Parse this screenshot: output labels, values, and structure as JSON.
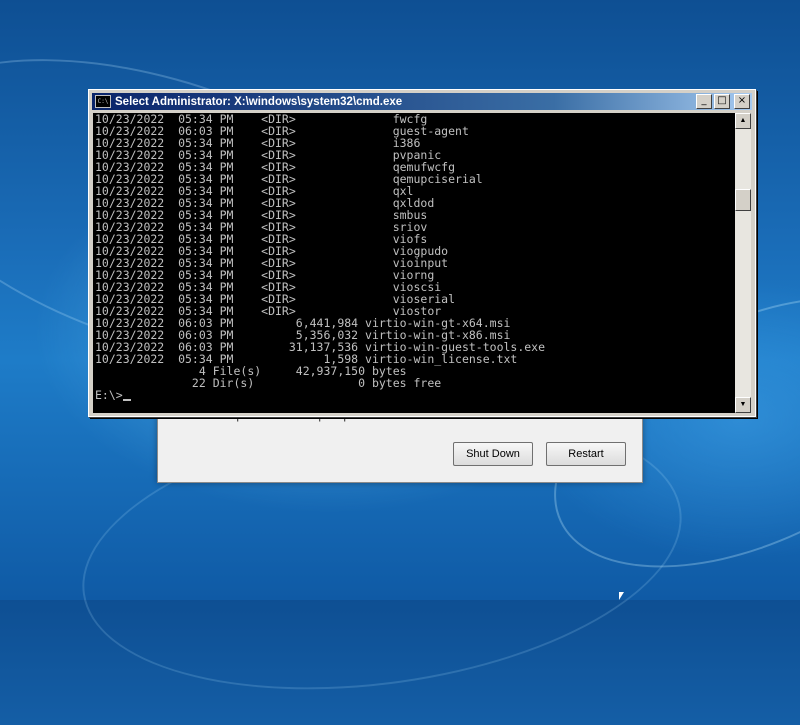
{
  "window": {
    "title": "Select Administrator: X:\\windows\\system32\\cmd.exe",
    "icon": "cmd-window-icon",
    "icon_text": "C:\\",
    "minimize_icon": "_",
    "maximize_icon": "□",
    "close_icon": "×"
  },
  "console": {
    "lines": [
      {
        "date": "10/23/2022",
        "time": "05:34 PM",
        "type": "<DIR>",
        "size": "",
        "name": "fwcfg"
      },
      {
        "date": "10/23/2022",
        "time": "06:03 PM",
        "type": "<DIR>",
        "size": "",
        "name": "guest-agent"
      },
      {
        "date": "10/23/2022",
        "time": "05:34 PM",
        "type": "<DIR>",
        "size": "",
        "name": "i386"
      },
      {
        "date": "10/23/2022",
        "time": "05:34 PM",
        "type": "<DIR>",
        "size": "",
        "name": "pvpanic"
      },
      {
        "date": "10/23/2022",
        "time": "05:34 PM",
        "type": "<DIR>",
        "size": "",
        "name": "qemufwcfg"
      },
      {
        "date": "10/23/2022",
        "time": "05:34 PM",
        "type": "<DIR>",
        "size": "",
        "name": "qemupciserial"
      },
      {
        "date": "10/23/2022",
        "time": "05:34 PM",
        "type": "<DIR>",
        "size": "",
        "name": "qxl"
      },
      {
        "date": "10/23/2022",
        "time": "05:34 PM",
        "type": "<DIR>",
        "size": "",
        "name": "qxldod"
      },
      {
        "date": "10/23/2022",
        "time": "05:34 PM",
        "type": "<DIR>",
        "size": "",
        "name": "smbus"
      },
      {
        "date": "10/23/2022",
        "time": "05:34 PM",
        "type": "<DIR>",
        "size": "",
        "name": "sriov"
      },
      {
        "date": "10/23/2022",
        "time": "05:34 PM",
        "type": "<DIR>",
        "size": "",
        "name": "viofs"
      },
      {
        "date": "10/23/2022",
        "time": "05:34 PM",
        "type": "<DIR>",
        "size": "",
        "name": "viogpudo"
      },
      {
        "date": "10/23/2022",
        "time": "05:34 PM",
        "type": "<DIR>",
        "size": "",
        "name": "vioinput"
      },
      {
        "date": "10/23/2022",
        "time": "05:34 PM",
        "type": "<DIR>",
        "size": "",
        "name": "viorng"
      },
      {
        "date": "10/23/2022",
        "time": "05:34 PM",
        "type": "<DIR>",
        "size": "",
        "name": "vioscsi"
      },
      {
        "date": "10/23/2022",
        "time": "05:34 PM",
        "type": "<DIR>",
        "size": "",
        "name": "vioserial"
      },
      {
        "date": "10/23/2022",
        "time": "05:34 PM",
        "type": "<DIR>",
        "size": "",
        "name": "viostor"
      },
      {
        "date": "10/23/2022",
        "time": "06:03 PM",
        "type": "",
        "size": "6,441,984",
        "name": "virtio-win-gt-x64.msi"
      },
      {
        "date": "10/23/2022",
        "time": "06:03 PM",
        "type": "",
        "size": "5,356,032",
        "name": "virtio-win-gt-x86.msi"
      },
      {
        "date": "10/23/2022",
        "time": "06:03 PM",
        "type": "",
        "size": "31,137,536",
        "name": "virtio-win-guest-tools.exe"
      },
      {
        "date": "10/23/2022",
        "time": "05:34 PM",
        "type": "",
        "size": "1,598",
        "name": "virtio-win_license.txt"
      }
    ],
    "summary_files": "               4 File(s)     42,937,150 bytes",
    "summary_dirs": "              22 Dir(s)               0 bytes free",
    "prompt": "E:\\>"
  },
  "scrollbar": {
    "up_icon": "▲",
    "down_icon": "▼"
  },
  "recovery_dialog": {
    "item_label": "Open a command prompt window",
    "shutdown_label": "Shut Down",
    "restart_label": "Restart"
  }
}
